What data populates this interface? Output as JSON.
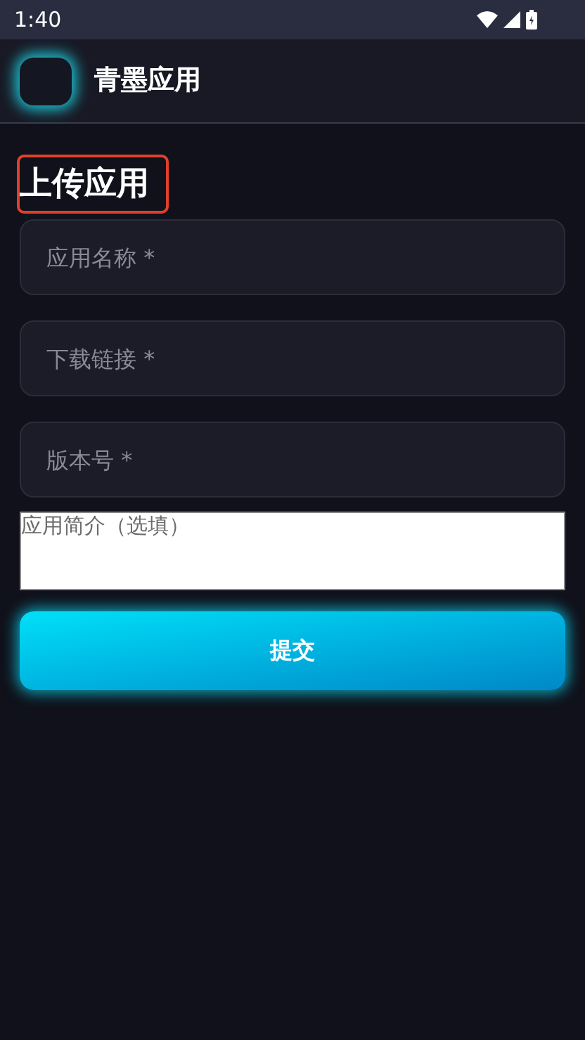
{
  "status_bar": {
    "time": "1:40"
  },
  "app_bar": {
    "title": "青墨应用"
  },
  "page_title": "上传应用",
  "fields": [
    {
      "placeholder": "应用名称 *"
    },
    {
      "placeholder": "下载链接 *"
    },
    {
      "placeholder": "版本号 *"
    }
  ],
  "description": {
    "placeholder": "应用简介（选填）"
  },
  "submit_button": "提交"
}
